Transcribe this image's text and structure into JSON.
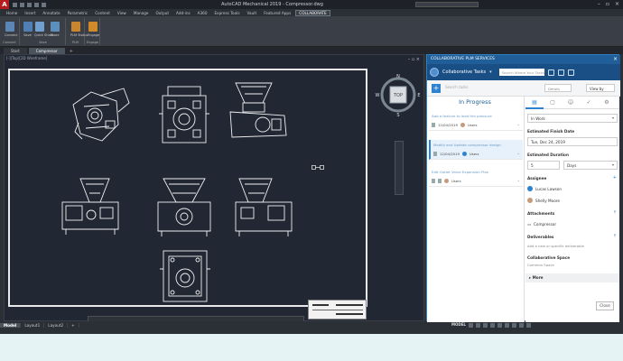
{
  "titlebar": {
    "logo": "A",
    "title": "AutoCAD Mechanical 2019 - Compressor.dwg"
  },
  "ribbon_tabs": [
    "Home",
    "Insert",
    "Annotate",
    "Parametric",
    "Content",
    "View",
    "Manage",
    "Output",
    "Add-ins",
    "A360",
    "Express Tools",
    "Vault",
    "Featured Apps",
    "COLLABORATE"
  ],
  "ribbon": {
    "buttons": [
      {
        "label": "Connect"
      },
      {
        "label": "Save"
      },
      {
        "label": "Quick Share"
      },
      {
        "label": "Share"
      },
      {
        "label": "PLM Status"
      },
      {
        "label": "Engage"
      }
    ],
    "groups": [
      "Connect",
      "Save",
      "PLM",
      "Engage"
    ]
  },
  "doc_tabs": [
    "Start",
    "Compressor"
  ],
  "viewport": {
    "label": "[-][Top][2D Wireframe]",
    "compass_top": "N",
    "compass_bottom": "S",
    "compass_left": "W",
    "compass_right": "E",
    "cube_face": "TOP",
    "window_ctrl": "– ▫ ×"
  },
  "status_tabs": [
    "Model",
    "Layout1",
    "Layout2",
    "+"
  ],
  "status_right": "MODEL",
  "panel": {
    "header": "COLLABORATIVE PLM SERVICES",
    "workspace": "Collaborative Tasks",
    "search_placeholder": "Search Where Your Tasks",
    "add_label": "+",
    "toolbar_search": "Search tasks",
    "details_placeholder": "Details",
    "view_by": "View by",
    "list_header": "In Progress",
    "tasks": [
      {
        "title": "Add a feature to lead the pressure",
        "date": "12/04/2019",
        "assignee": "Users"
      },
      {
        "title": "Modify and Update compressor design",
        "date": "12/04/2019",
        "assignee": "Users"
      },
      {
        "title": "Edit Outlet Valve Expansion Plan",
        "date": "",
        "assignee": "Users"
      }
    ],
    "detail": {
      "status": "In Work",
      "finish_label": "Estimated Finish Date",
      "finish_value": "Tue, Dec 24, 2019",
      "duration_label": "Estimated Duration",
      "duration_value": "5",
      "duration_unit": "Days",
      "assignees_label": "Assignee",
      "assignees": [
        "Lucas Lawson",
        "Shelly Moore"
      ],
      "attachments_label": "Attachments",
      "attachment": "Compressor",
      "deliverables_label": "Deliverables",
      "deliverables_placeholder": "Add a new or specific deliverable",
      "collab_label": "Collaborative Space",
      "collab_value": "Common Space",
      "more_label": "More",
      "close_label": "Close"
    }
  },
  "colors": {
    "panel_header": "#1f5e99",
    "accent": "#2e82cf",
    "viewport_bg": "#212834",
    "page_bg": "#e6f3f5"
  }
}
